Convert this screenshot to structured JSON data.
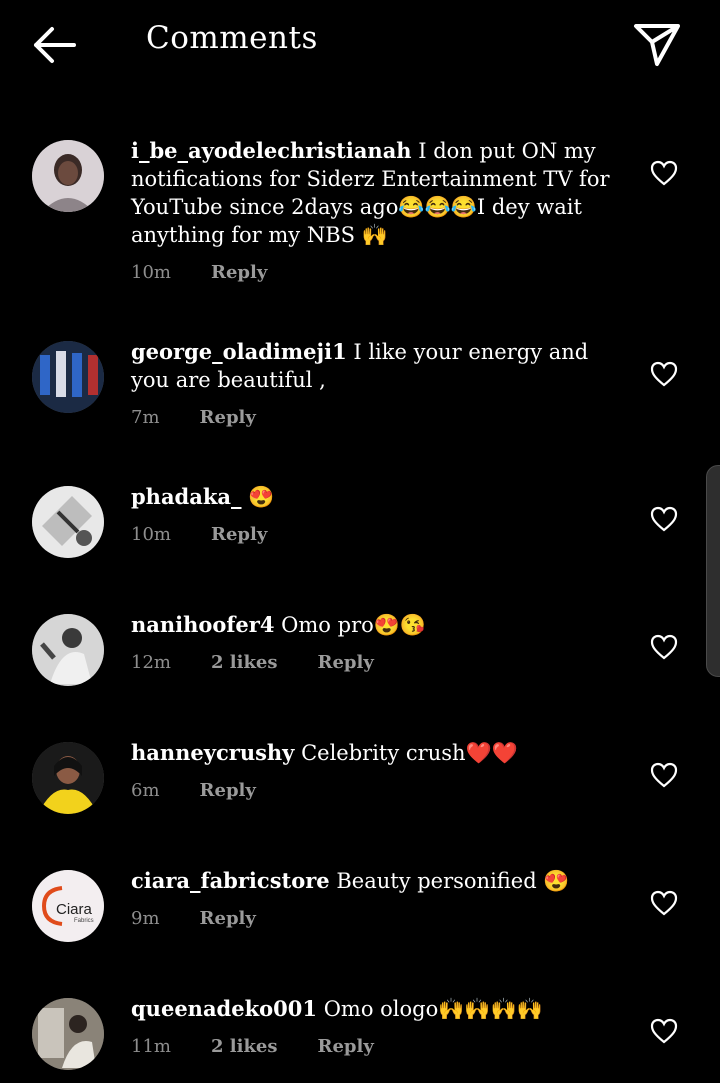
{
  "header": {
    "title": "Comments"
  },
  "labels": {
    "reply": "Reply"
  },
  "comments": [
    {
      "username": "i_be_ayodelechristianah",
      "text": "I don put ON my notifications for Siderz Entertainment TV for YouTube since 2days ago😂😂😂I dey wait anything for my NBS 🙌",
      "time": "10m",
      "likes": ""
    },
    {
      "username": "george_oladimeji1",
      "text": "I like your energy and you are beautiful ,",
      "time": "7m",
      "likes": ""
    },
    {
      "username": "phadaka_",
      "text": "😍",
      "time": "10m",
      "likes": ""
    },
    {
      "username": "nanihoofer4",
      "text": "Omo pro😍😘",
      "time": "12m",
      "likes": "2 likes"
    },
    {
      "username": "hanneycrushy",
      "text": "Celebrity crush❤️❤️",
      "time": "6m",
      "likes": ""
    },
    {
      "username": "ciara_fabricstore",
      "text": "Beauty personified 😍",
      "time": "9m",
      "likes": ""
    },
    {
      "username": "queenadeko001",
      "text": "Omo ologo🙌🙌🙌🙌",
      "time": "11m",
      "likes": "2 likes"
    }
  ],
  "avatar_texts": {
    "ciara": "Ciara",
    "ciara_sub": "Fabrics"
  }
}
